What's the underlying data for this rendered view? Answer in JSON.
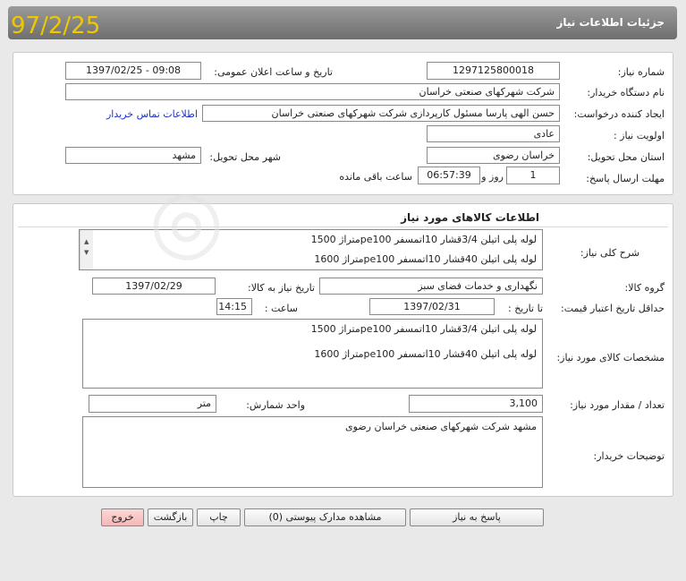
{
  "header": {
    "title": "جزئیات اطلاعات نیاز",
    "date_stamp": "97/2/25"
  },
  "info": {
    "need_number_label": "شماره نیاز:",
    "need_number": "1297125800018",
    "announce_label": "تاریخ و ساعت اعلان عمومی:",
    "announce_value": "1397/02/25 - 09:08",
    "buyer_org_label": "نام دستگاه خریدار:",
    "buyer_org": "شرکت شهرکهای صنعتی خراسان",
    "creator_label": "ایجاد کننده درخواست:",
    "creator": "حسن الهی پارسا مسئول کارپردازی شرکت شهرکهای صنعتی خراسان",
    "contact_link": "اطلاعات تماس خریدار",
    "priority_label": "اولویت نیاز :",
    "priority": "عادی",
    "province_label": "استان محل تحویل:",
    "province": "خراسان رضوی",
    "city_label": "شهر محل تحویل:",
    "city": "مشهد",
    "deadline_label": "مهلت ارسال پاسخ:",
    "deadline_days": "1",
    "days_word": "روز و",
    "deadline_time": "06:57:39",
    "remaining_word": "ساعت باقی مانده"
  },
  "goods": {
    "section_title": "اطلاعات کالاهای مورد نیاز",
    "summary_label": "شرح کلی نیاز:",
    "summary_line1": "لوله پلی اتیلن 3/4قشار 10اتمسفر pe100متراژ 1500",
    "summary_line2": "لوله پلی اتیلن 40قشار 10اتمسفر pe100متراژ 1600",
    "group_label": "گروه کالا:",
    "group": "نگهداری و خدمات فضای سبز",
    "need_date_label": "تاریخ نیاز به کالا:",
    "need_date": "1397/02/29",
    "validity_label": "حداقل تاریخ اعتبار قیمت:",
    "until_label": "تا تاریخ :",
    "until_date": "1397/02/31",
    "time_label": "ساعت :",
    "time": "14:15",
    "specs_label": "مشخصات کالای مورد نیاز:",
    "spec_line1": "لوله پلی اتیلن 3/4قشار 10اتمسفر pe100متراژ 1500",
    "spec_line2": "لوله پلی اتیلن 40قشار 10اتمسفر pe100متراژ 1600",
    "qty_label": "تعداد / مقدار مورد نیاز:",
    "qty": "3,100",
    "unit_label": "واحد شمارش:",
    "unit": "متر",
    "notes_label": "توضیحات خریدار:",
    "notes": "مشهد شرکت شهرکهای صنعتی خراسان رضوی"
  },
  "buttons": {
    "reply": "پاسخ به نیاز",
    "attachments": "مشاهده مدارک پیوستی (0)",
    "print": "چاپ",
    "back": "بازگشت",
    "exit": "خروج"
  },
  "colors": {
    "title_bar": "#7f7f7f",
    "link": "#1a33c8",
    "exit_button": "#f4b8b8",
    "date_stamp": "#f0c800"
  }
}
